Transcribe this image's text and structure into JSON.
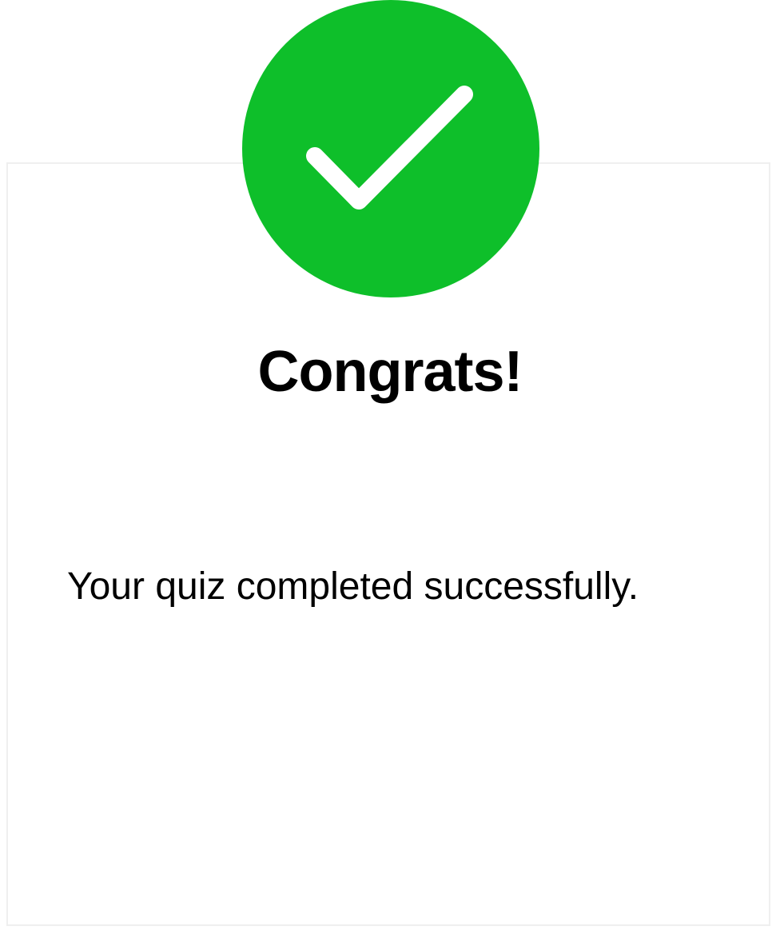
{
  "success": {
    "icon": "check-icon",
    "badge_color": "#0ebf2a"
  },
  "dialog": {
    "title": "Congrats!",
    "message": "Your quiz completed successfully."
  }
}
